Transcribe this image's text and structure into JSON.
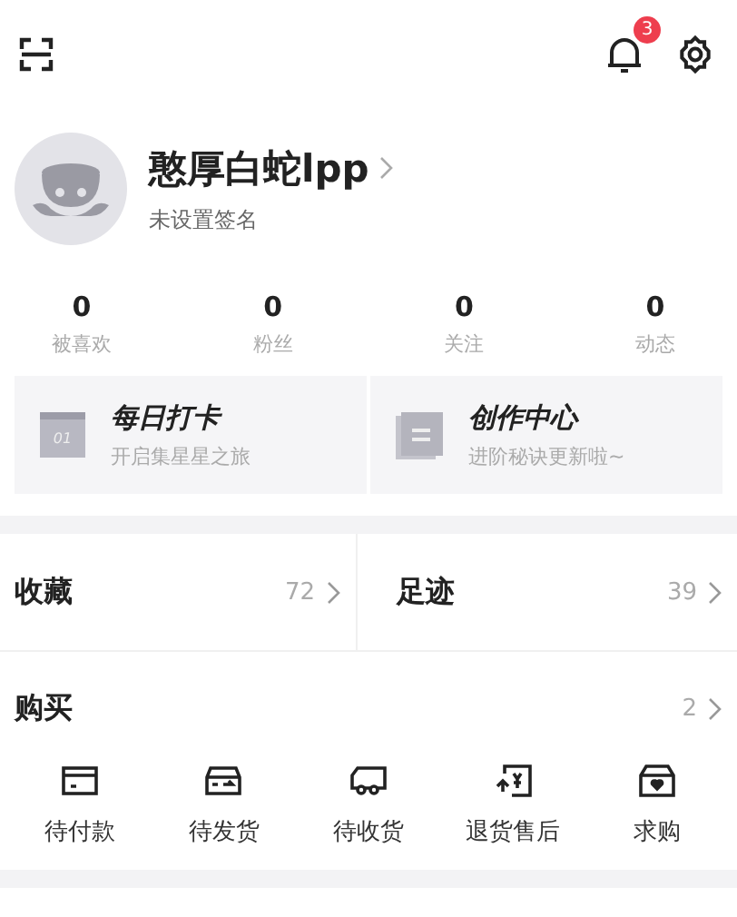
{
  "header": {
    "notification_count": "3"
  },
  "profile": {
    "name": "憨厚白蛇lpp",
    "signature": "未设置签名"
  },
  "stats": [
    {
      "value": "0",
      "label": "被喜欢"
    },
    {
      "value": "0",
      "label": "粉丝"
    },
    {
      "value": "0",
      "label": "关注"
    },
    {
      "value": "0",
      "label": "动态"
    }
  ],
  "cards": [
    {
      "kind": "calendar",
      "title": "每日打卡",
      "subtitle": "开启集星星之旅",
      "icon_text": "01"
    },
    {
      "kind": "document",
      "title": "创作中心",
      "subtitle": "进阶秘诀更新啦~"
    }
  ],
  "shortcuts": [
    {
      "label": "收藏",
      "count": "72"
    },
    {
      "label": "足迹",
      "count": "39"
    }
  ],
  "purchase": {
    "title": "购买",
    "count": "2",
    "items": [
      {
        "kind": "card",
        "label": "待付款"
      },
      {
        "kind": "box",
        "label": "待发货"
      },
      {
        "kind": "truck",
        "label": "待收货"
      },
      {
        "kind": "refund",
        "label": "退货售后"
      },
      {
        "kind": "bag",
        "label": "求购"
      }
    ]
  }
}
